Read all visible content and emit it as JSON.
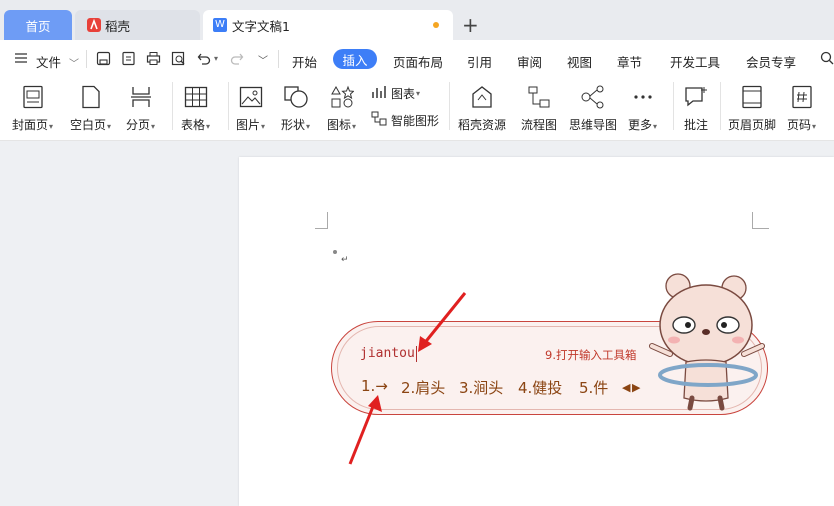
{
  "tabs": {
    "home": "首页",
    "daoke": "稻壳",
    "doc": "文字文稿1"
  },
  "menu": {
    "file": "文件",
    "items": [
      "开始",
      "插入",
      "页面布局",
      "引用",
      "审阅",
      "视图",
      "章节",
      "开发工具",
      "会员专享"
    ],
    "active": "插入"
  },
  "ribbon": {
    "cover": "封面页",
    "blank": "空白页",
    "pagebreak": "分页",
    "table": "表格",
    "picture": "图片",
    "shape": "形状",
    "icon": "图标",
    "chart": "图表",
    "smartart": "智能图形",
    "daoke_res": "稻壳资源",
    "flowchart": "流程图",
    "mindmap": "思维导图",
    "more": "更多",
    "comment": "批注",
    "header_footer": "页眉页脚",
    "page_number": "页码"
  },
  "ime": {
    "pinyin": "jiantou",
    "tool_hint": "9.打开输入工具箱",
    "candidates": [
      "1.→",
      "2.肩头",
      "3.涧头",
      "4.健投",
      "5.件"
    ]
  },
  "colors": {
    "accent": "#3d7ef7",
    "home_tab": "#6e9cf5",
    "ime_border": "#c9453e",
    "candidate_text": "#8b4513",
    "annotation_arrow": "#e02020"
  }
}
